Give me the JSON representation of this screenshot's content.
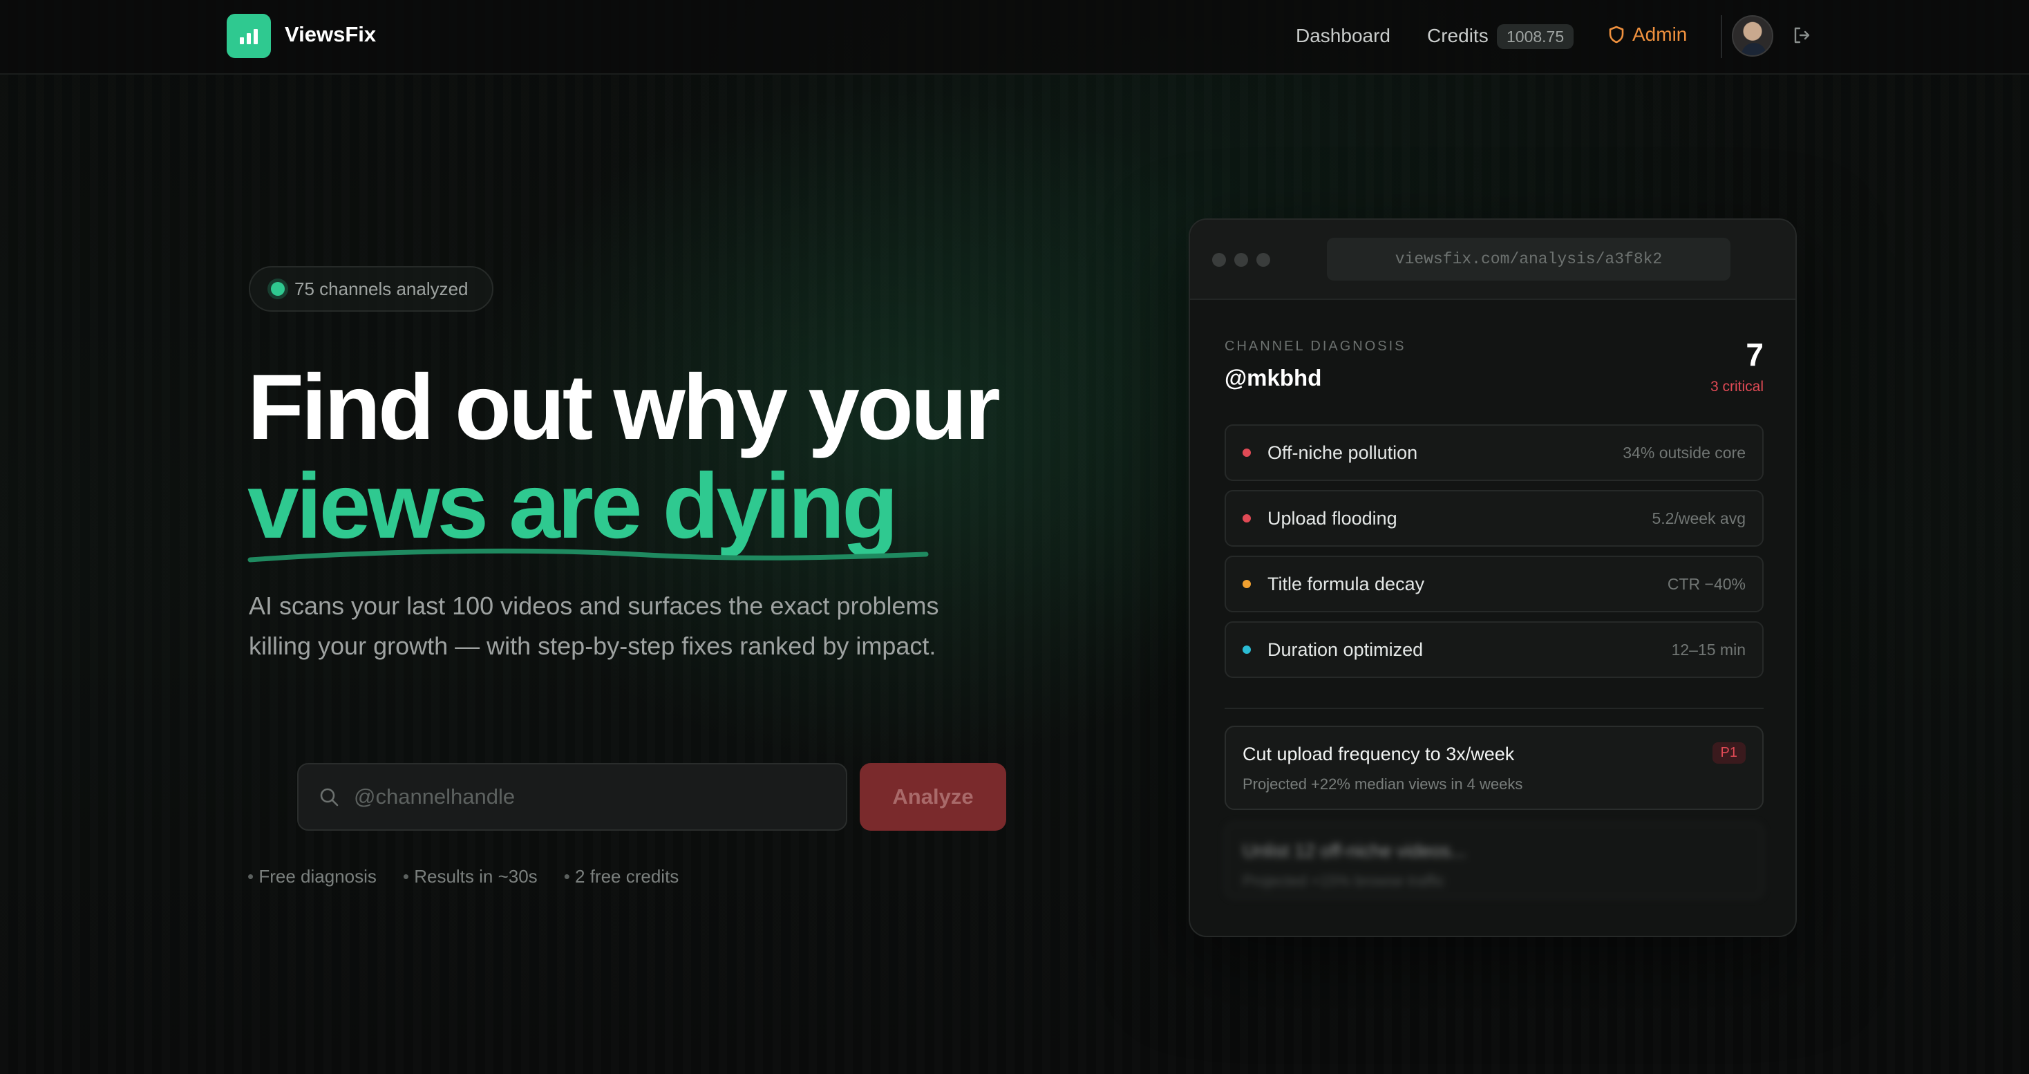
{
  "nav": {
    "brand": "ViewsFix",
    "dashboard": "Dashboard",
    "credits_label": "Credits",
    "credits_value": "1008.75",
    "admin": "Admin"
  },
  "hero": {
    "pill_text": "75 channels analyzed",
    "headline_line1": "Find out why your",
    "headline_line2": "views are dying",
    "subtitle": "AI scans your last 100 videos and surfaces the exact problems killing your growth — with step-by-step fixes ranked by impact.",
    "search_placeholder": "@channelhandle",
    "analyze_label": "Analyze",
    "features": [
      "Free diagnosis",
      "Results in ~30s",
      "2 free credits"
    ]
  },
  "preview": {
    "url": "viewsfix.com/analysis/a3f8k2",
    "diagnosis_label": "CHANNEL DIAGNOSIS",
    "handle": "@mkbhd",
    "issue_count": "7",
    "critical_text": "3 critical",
    "issues": [
      {
        "name": "Off-niche pollution",
        "metric": "34% outside core",
        "color": "#e04a55"
      },
      {
        "name": "Upload flooding",
        "metric": "5.2/week avg",
        "color": "#e04a55"
      },
      {
        "name": "Title formula decay",
        "metric": "CTR −40%",
        "color": "#f0a030"
      },
      {
        "name": "Duration optimized",
        "metric": "12–15 min",
        "color": "#2bbcd4"
      }
    ],
    "fixes": [
      {
        "title": "Cut upload frequency to 3x/week",
        "subtitle": "Projected +22% median views in 4 weeks",
        "priority": "P1"
      },
      {
        "title": "Unlist 12 off-niche videos...",
        "subtitle": "Projected +15% browse traffic",
        "priority": ""
      }
    ]
  },
  "colors": {
    "accent": "#2fc990",
    "admin": "#f0913e",
    "danger": "#e04a55"
  },
  "icons": [
    "logo-icon",
    "shield-icon",
    "avatar",
    "logout-icon",
    "search-icon"
  ]
}
